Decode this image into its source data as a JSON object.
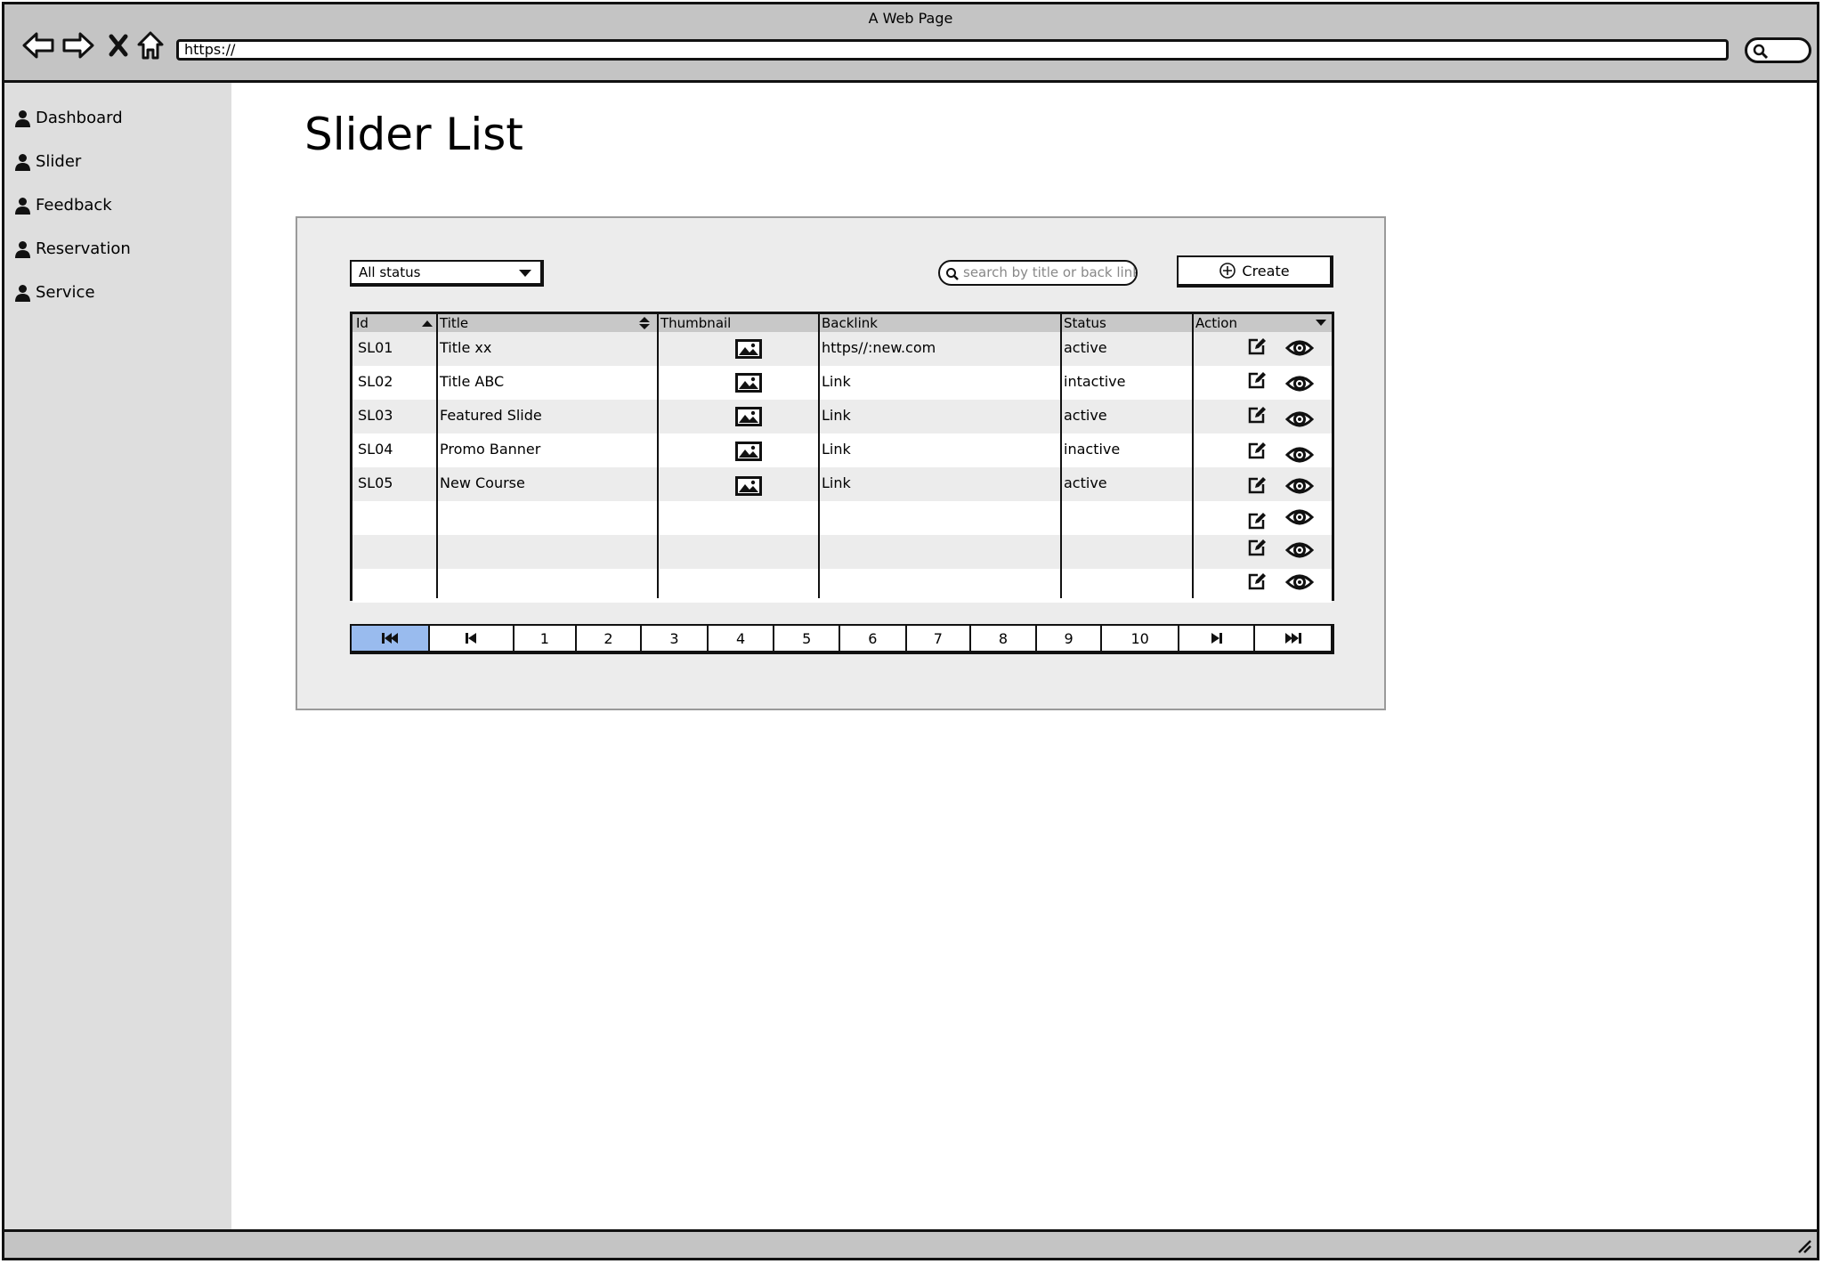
{
  "browser": {
    "title": "A Web Page",
    "url": "https://"
  },
  "sidebar": {
    "items": [
      {
        "label": "Dashboard",
        "icon": "user-icon"
      },
      {
        "label": "Slider",
        "icon": "user-icon"
      },
      {
        "label": "Feedback",
        "icon": "user-icon"
      },
      {
        "label": "Reservation",
        "icon": "user-icon"
      },
      {
        "label": "Service",
        "icon": "user-icon"
      }
    ]
  },
  "main": {
    "title": "Slider List",
    "status_filter": {
      "selected": "All status"
    },
    "search": {
      "placeholder": "search by title or back link"
    },
    "create_label": "Create"
  },
  "table": {
    "columns": [
      "Id",
      "Title",
      "Thumbnail",
      "Backlink",
      "Status",
      "Action"
    ],
    "rows": [
      {
        "id": "SL01",
        "title": "Title xx",
        "backlink": "https//:new.com",
        "status": "active"
      },
      {
        "id": "SL02",
        "title": "Title ABC",
        "backlink": "Link",
        "status": "intactive"
      },
      {
        "id": "SL03",
        "title": "Featured Slide",
        "backlink": "Link",
        "status": "active"
      },
      {
        "id": "SL04",
        "title": "Promo Banner",
        "backlink": "Link",
        "status": "inactive"
      },
      {
        "id": "SL05",
        "title": "New Course",
        "backlink": "Link",
        "status": "active"
      }
    ],
    "empty_action_rows": 3
  },
  "pagination": {
    "pages": [
      "1",
      "2",
      "3",
      "4",
      "5",
      "6",
      "7",
      "8",
      "9",
      "10"
    ],
    "active": "first"
  },
  "colors": {
    "chrome": "#c4c4c4",
    "sidebar": "#dedede",
    "panel": "#ececec",
    "active_page": "#99bbee"
  }
}
